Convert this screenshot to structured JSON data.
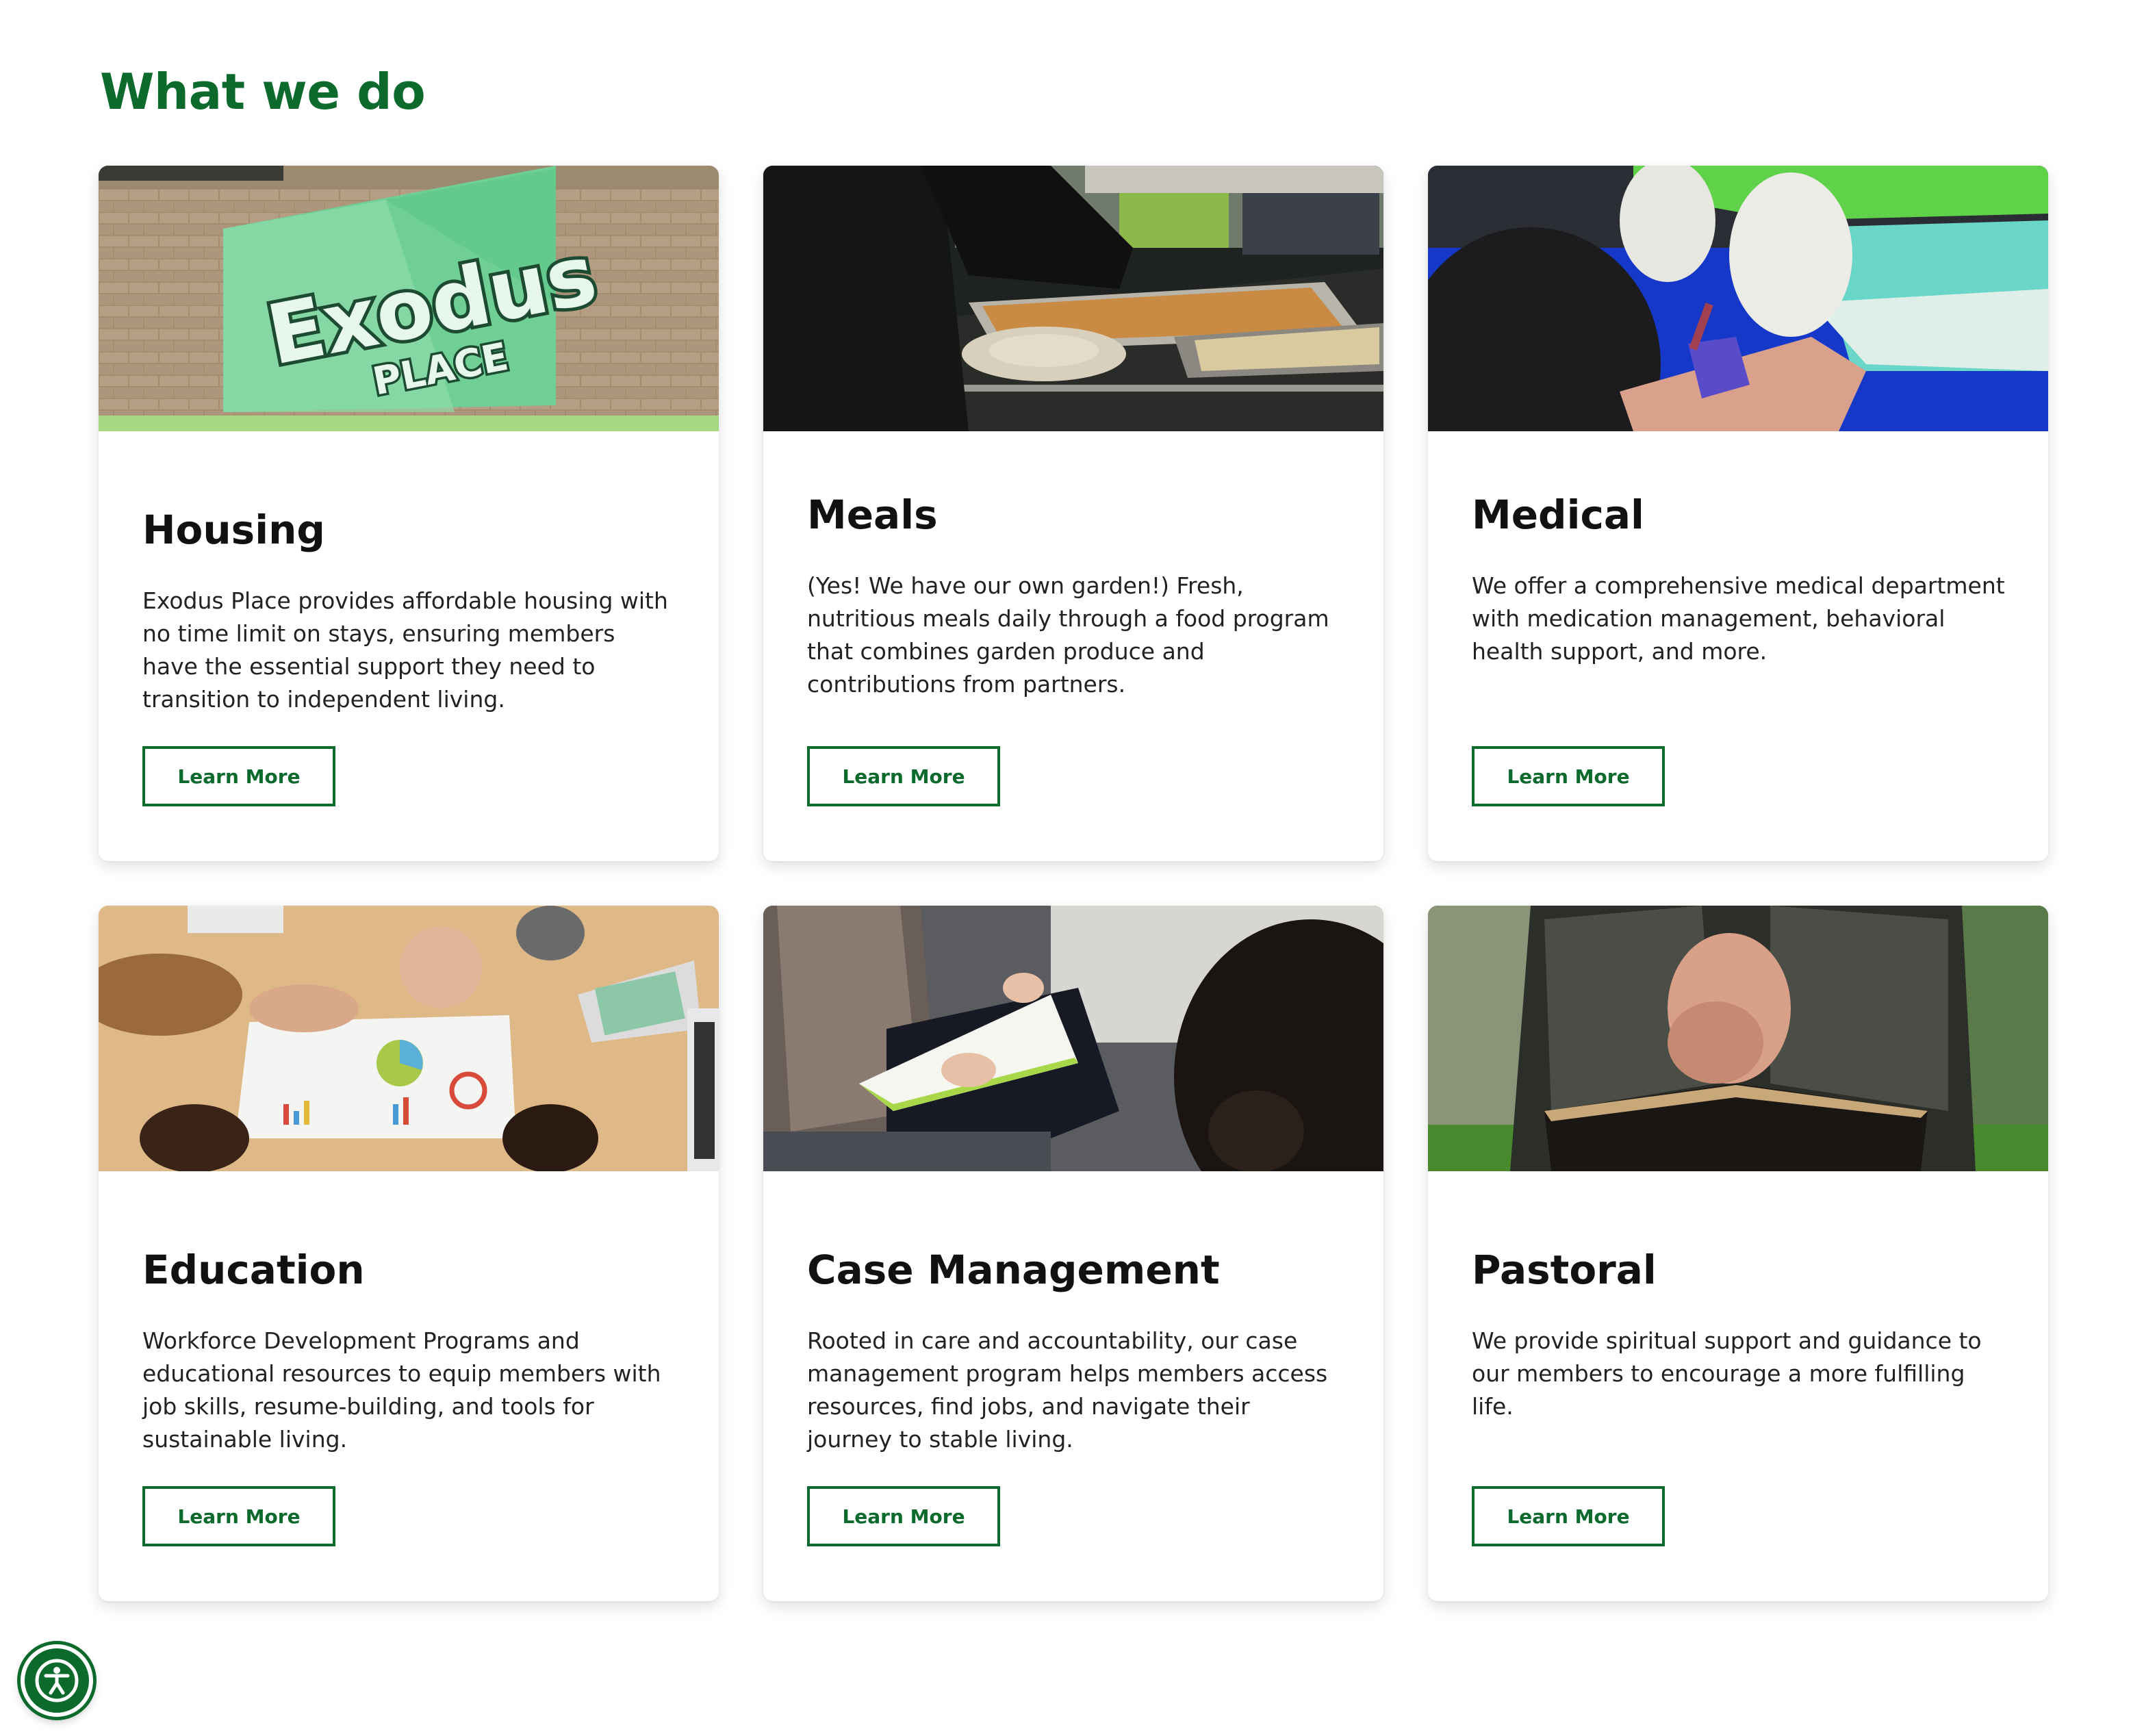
{
  "section": {
    "title": "What we do"
  },
  "colors": {
    "brand_green": "#0b6a2c"
  },
  "cards": [
    {
      "title": "Housing",
      "text": "Exodus Place provides affordable housing with no time limit on stays, ensuring members have the essential support they need to transition to independent living.",
      "button": "Learn More",
      "image": "exodus-place-banner-photo",
      "banner_text_1": "Exodus",
      "banner_text_2": "PLACE"
    },
    {
      "title": "Meals",
      "text": "(Yes! We have our own garden!) Fresh, nutritious meals daily through a food program that combines garden produce and contributions from partners.",
      "button": "Learn More",
      "image": "serving-meals-photo"
    },
    {
      "title": "Medical",
      "text": "We offer a comprehensive medical department with medication management, behavioral health support, and more.",
      "button": "Learn More",
      "image": "blood-draw-photo"
    },
    {
      "title": "Education",
      "text": "Workforce Development Programs and educational resources to equip members with job skills, resume-building, and tools for sustainable living.",
      "button": "Learn More",
      "image": "team-reviewing-charts-photo"
    },
    {
      "title": "Case Management",
      "text": "Rooted in care and accountability, our case management program helps members access resources, find jobs, and navigate their journey to stable living.",
      "button": "Learn More",
      "image": "counseling-session-photo"
    },
    {
      "title": "Pastoral",
      "text": "We provide spiritual support and guidance to our members to encourage a more fulfilling life.",
      "button": "Learn More",
      "image": "praying-hands-bible-photo"
    }
  ],
  "accessibility_widget": {
    "icon": "accessibility-icon"
  }
}
